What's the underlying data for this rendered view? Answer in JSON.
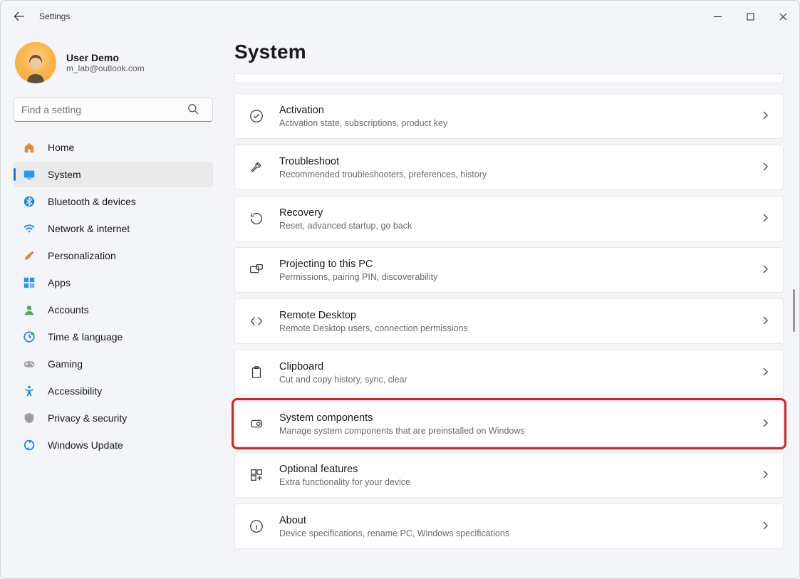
{
  "window": {
    "title": "Settings"
  },
  "user": {
    "name": "User Demo",
    "email": "m_lab@outlook.com"
  },
  "search": {
    "placeholder": "Find a setting"
  },
  "nav": {
    "items": [
      {
        "label": "Home"
      },
      {
        "label": "System"
      },
      {
        "label": "Bluetooth & devices"
      },
      {
        "label": "Network & internet"
      },
      {
        "label": "Personalization"
      },
      {
        "label": "Apps"
      },
      {
        "label": "Accounts"
      },
      {
        "label": "Time & language"
      },
      {
        "label": "Gaming"
      },
      {
        "label": "Accessibility"
      },
      {
        "label": "Privacy & security"
      },
      {
        "label": "Windows Update"
      }
    ]
  },
  "page": {
    "title": "System"
  },
  "cards": [
    {
      "title": "Activation",
      "desc": "Activation state, subscriptions, product key"
    },
    {
      "title": "Troubleshoot",
      "desc": "Recommended troubleshooters, preferences, history"
    },
    {
      "title": "Recovery",
      "desc": "Reset, advanced startup, go back"
    },
    {
      "title": "Projecting to this PC",
      "desc": "Permissions, pairing PIN, discoverability"
    },
    {
      "title": "Remote Desktop",
      "desc": "Remote Desktop users, connection permissions"
    },
    {
      "title": "Clipboard",
      "desc": "Cut and copy history, sync, clear"
    },
    {
      "title": "System components",
      "desc": "Manage system components that are preinstalled on Windows"
    },
    {
      "title": "Optional features",
      "desc": "Extra functionality for your device"
    },
    {
      "title": "About",
      "desc": "Device specifications, rename PC, Windows specifications"
    }
  ]
}
